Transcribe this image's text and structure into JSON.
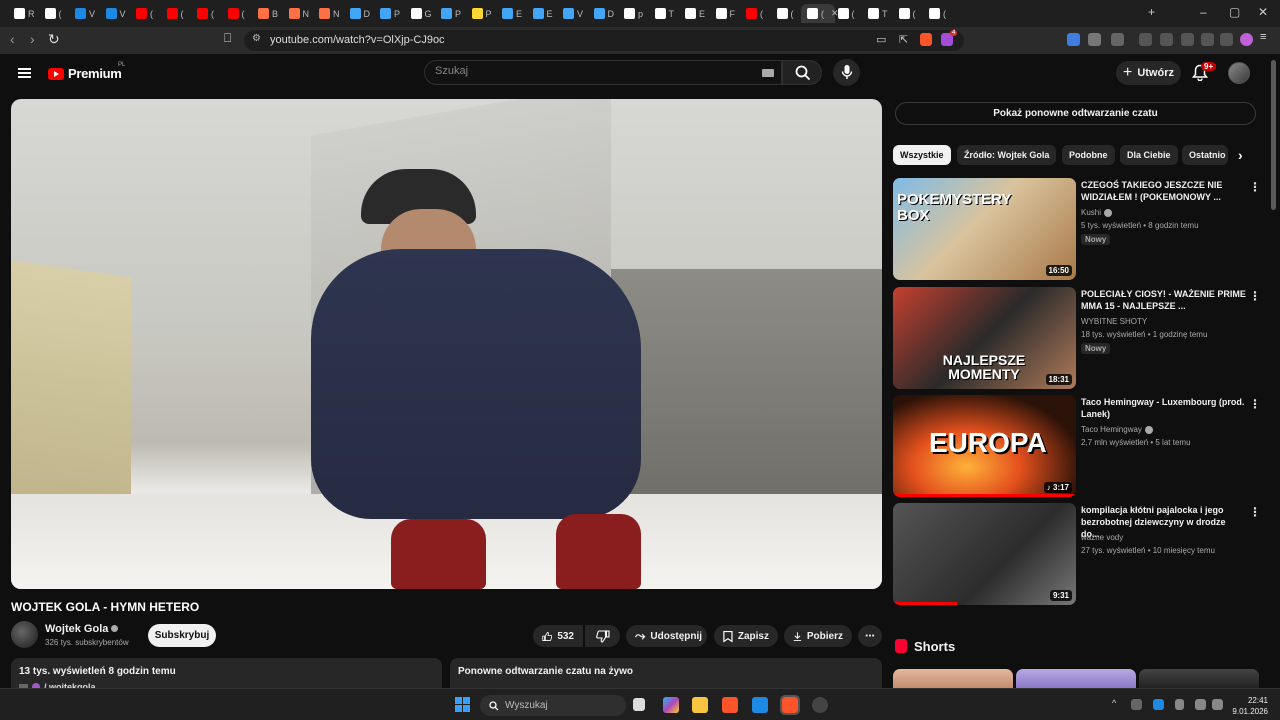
{
  "browser": {
    "tabs": [
      {
        "label": "R",
        "color": "#ffffff"
      },
      {
        "label": "(",
        "color": "#ffffff"
      },
      {
        "label": "V",
        "color": "#1e88e5"
      },
      {
        "label": "V",
        "color": "#1e88e5"
      },
      {
        "label": "(",
        "color": "#ff0000"
      },
      {
        "label": "(",
        "color": "#ff0000"
      },
      {
        "label": "(",
        "color": "#ff0000"
      },
      {
        "label": "(",
        "color": "#ff0000"
      },
      {
        "label": "B",
        "color": "#ff7043"
      },
      {
        "label": "N",
        "color": "#ff7043"
      },
      {
        "label": "N",
        "color": "#ff7043"
      },
      {
        "label": "D",
        "color": "#42a5f5"
      },
      {
        "label": "P",
        "color": "#42a5f5"
      },
      {
        "label": "G",
        "color": "#ffffff"
      },
      {
        "label": "P",
        "color": "#42a5f5"
      },
      {
        "label": "P",
        "color": "#fdd835"
      },
      {
        "label": "E",
        "color": "#42a5f5"
      },
      {
        "label": "E",
        "color": "#42a5f5"
      },
      {
        "label": "V",
        "color": "#42a5f5"
      },
      {
        "label": "D",
        "color": "#42a5f5"
      },
      {
        "label": "p",
        "color": "#ffffff"
      },
      {
        "label": "T",
        "color": "#ffffff"
      },
      {
        "label": "E",
        "color": "#ffffff"
      },
      {
        "label": "F",
        "color": "#ffffff"
      },
      {
        "label": "(",
        "color": "#ff0000"
      },
      {
        "label": "(",
        "color": "#ffffff"
      },
      {
        "label": "(",
        "color": "#ffffff"
      },
      {
        "label": "(",
        "color": "#ffffff"
      },
      {
        "label": "T",
        "color": "#ffffff"
      },
      {
        "label": "(",
        "color": "#ffffff"
      },
      {
        "label": "(",
        "color": "#ffffff"
      }
    ],
    "active_tab_index": 26,
    "url": "youtube.com/watch?v=OlXjp-CJ9oc",
    "ext_badge": "4"
  },
  "header": {
    "logo_text": "Premium",
    "logo_sup": "PL",
    "search_placeholder": "Szukaj",
    "create_label": "Utwórz",
    "notif_badge": "9+"
  },
  "video": {
    "title": "WOJTEK GOLA - HYMN HETERO",
    "channel": "Wojtek Gola",
    "subscribers": "326 tys. subskrybentów",
    "subscribe_label": "Subskrybuj",
    "likes": "532",
    "share_label": "Udostępnij",
    "save_label": "Zapisz",
    "download_label": "Pobierz",
    "views_line": "13 tys. wyświetleń  8 godzin temu",
    "desc_handle": "/ wojtekgola",
    "chat_replay_box": "Ponowne odtwarzanie czatu na żywo"
  },
  "sidebar": {
    "chat_button": "Pokaż ponowne odtwarzanie czatu",
    "chips": [
      "Wszystkie",
      "Źródło: Wojtek Gola",
      "Podobne",
      "Dla Ciebie",
      "Ostatnio"
    ],
    "recommendations": [
      {
        "title": "CZEGOŚ TAKIEGO JESZCZE NIE WIDZIAŁEM ! (POKEMONOWY ...",
        "channel": "Kushi",
        "verified": true,
        "meta": "5 tys. wyświetleń • 8 godzin temu",
        "badge": "Nowy",
        "duration": "16:50",
        "thumb_text": "POKEMYSTERY BOX"
      },
      {
        "title": "POLECIAŁY CIOSY! - WAŻENIE PRIME MMA 15 - NAJLEPSZE ...",
        "channel": "WYBITNE SHOTY",
        "verified": false,
        "meta": "18 tys. wyświetleń • 1 godzinę temu",
        "badge": "Nowy",
        "duration": "18:31",
        "thumb_text": "NAJLEPSZE MOMENTY"
      },
      {
        "title": "Taco Hemingway - Luxembourg (prod. Lanek)",
        "channel": "Taco Hemingway",
        "verified": true,
        "meta": "2,7 mln wyświetleń • 5 lat temu",
        "badge": "",
        "duration": "♪ 3:17",
        "thumb_text": "EUROPA"
      },
      {
        "title": "kompilacja kłótni pajalocka i jego bezrobotnej dziewczyny w drodze do...",
        "channel": "ważne vody",
        "verified": false,
        "meta": "27 tys. wyświetleń • 10 miesięcy temu",
        "badge": "",
        "duration": "9:31",
        "thumb_text": ""
      }
    ],
    "shorts_label": "Shorts"
  },
  "taskbar": {
    "search_placeholder": "Wyszukaj",
    "time": "22:41",
    "date": "9.01.2026"
  }
}
